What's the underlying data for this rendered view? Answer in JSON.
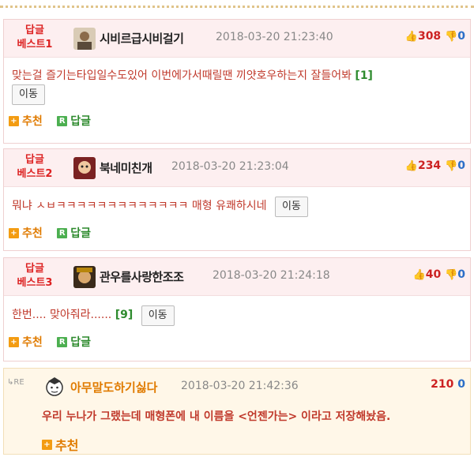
{
  "best": [
    {
      "rank_line1": "답글",
      "rank_line2": "베스트1",
      "nick": "시비르급시비걸기",
      "date": "2018-03-20 21:23:40",
      "up": "308",
      "down": "0",
      "text": "맞는걸 즐기는타입일수도있어 이번에가서때릴땐 끼얏호우하는지 잘들어봐",
      "count": "[1]",
      "move": "이동"
    },
    {
      "rank_line1": "답글",
      "rank_line2": "베스트2",
      "nick": "북네미친개",
      "date": "2018-03-20 21:23:04",
      "up": "234",
      "down": "0",
      "text": "뭐냐 ㅅㅂㅋㅋㅋㅋㅋㅋㅋㅋㅋㅋㅋㅋㅋ 매형 유쾌하시네",
      "count": "",
      "move": "이동"
    },
    {
      "rank_line1": "답글",
      "rank_line2": "베스트3",
      "nick": "관우를사랑한조조",
      "date": "2018-03-20 21:24:18",
      "up": "40",
      "down": "0",
      "text": "한번.... 맞아줘라......",
      "count": "[9]",
      "move": "이동"
    }
  ],
  "actions": {
    "recommend": "추천",
    "reply": "답글"
  },
  "reply": {
    "re_mark": "RE",
    "nick": "아무말도하기싫다",
    "date": "2018-03-20 21:42:36",
    "score": "210",
    "down": "0",
    "text": "우리 누나가 그랬는데 매형폰에 내 이름을 <언젠가는> 이라고 저장해놨음.",
    "recommend": "추천"
  },
  "colors": {
    "accent_red": "#c0392b",
    "best_bg": "#fdeff0",
    "reply_bg": "#fff7e8",
    "count_green": "#2e8b2e"
  },
  "icons": [
    "thumb-up-icon",
    "thumb-down-icon",
    "plus-icon",
    "reply-r-icon",
    "avatar-icon",
    "re-arrow-icon"
  ]
}
